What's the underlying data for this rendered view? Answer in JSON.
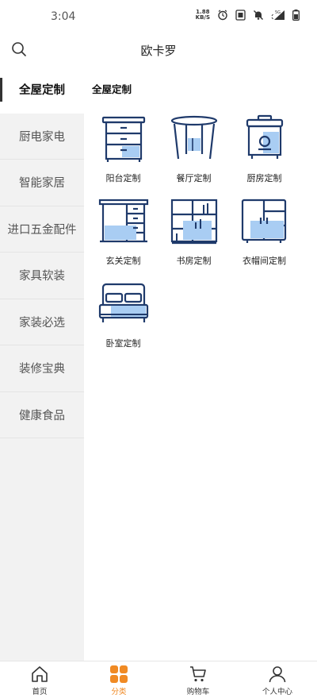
{
  "status_bar": {
    "time": "3:04",
    "net_speed_value": "1.88",
    "net_speed_unit": "KB/S",
    "network_label": "5G"
  },
  "header": {
    "title": "欧卡罗"
  },
  "sidebar": {
    "items": [
      {
        "label": "全屋定制",
        "active": true
      },
      {
        "label": "厨电家电"
      },
      {
        "label": "智能家居"
      },
      {
        "label": "进口五金配件"
      },
      {
        "label": "家具软装"
      },
      {
        "label": "家装必选"
      },
      {
        "label": "装修宝典"
      },
      {
        "label": "健康食品"
      }
    ]
  },
  "main": {
    "section_title": "全屋定制",
    "categories": [
      {
        "label": "阳台定制",
        "icon": "balcony-cabinet-icon"
      },
      {
        "label": "餐厅定制",
        "icon": "dining-table-icon"
      },
      {
        "label": "厨房定制",
        "icon": "kitchen-rice-cooker-icon"
      },
      {
        "label": "玄关定制",
        "icon": "entryway-cabinet-icon"
      },
      {
        "label": "书房定制",
        "icon": "bookshelf-icon"
      },
      {
        "label": "衣帽间定制",
        "icon": "wardrobe-icon"
      },
      {
        "label": "卧室定制",
        "icon": "bed-icon"
      }
    ]
  },
  "bottom_nav": {
    "items": [
      {
        "label": "首页",
        "icon": "home-icon"
      },
      {
        "label": "分类",
        "icon": "category-icon",
        "active": true
      },
      {
        "label": "购物车",
        "icon": "cart-icon"
      },
      {
        "label": "个人中心",
        "icon": "user-icon"
      }
    ]
  },
  "colors": {
    "icon_navy": "#1f3a6b",
    "icon_fill": "#a9cdf3",
    "accent_orange": "#f08a24",
    "sidebar_bg": "#f2f2f2"
  }
}
